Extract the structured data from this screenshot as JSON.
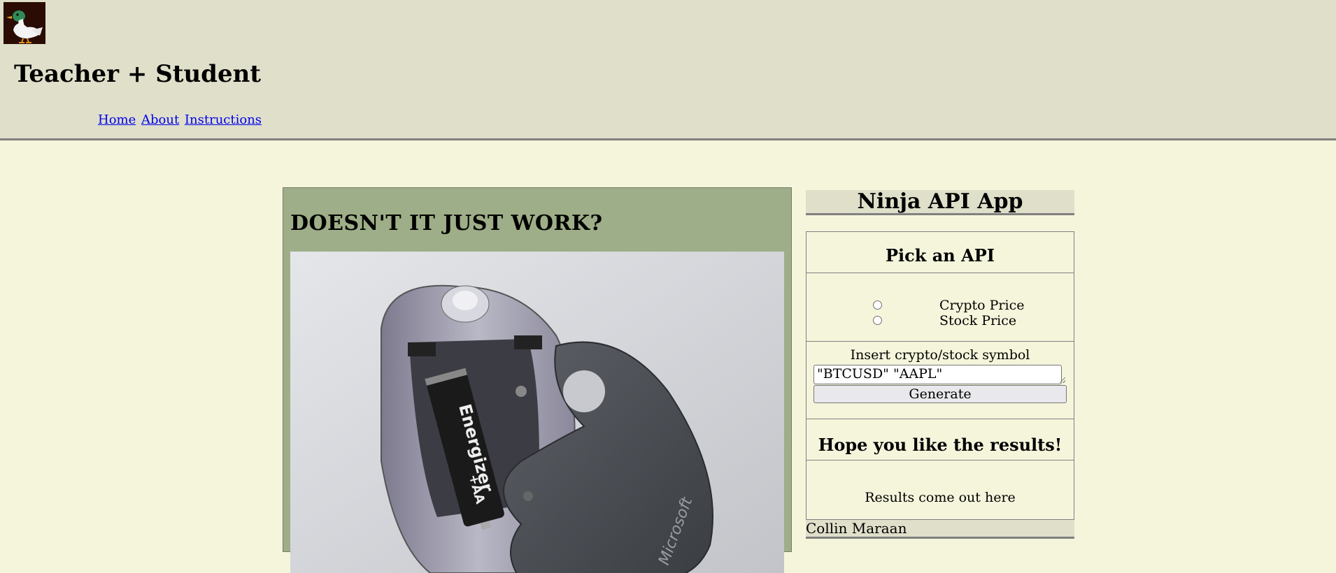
{
  "header": {
    "logo_alt": "duck logo",
    "site_title": "Teacher + Student",
    "nav": [
      "Home",
      "About",
      "Instructions"
    ]
  },
  "feature": {
    "title": "DOESN'T IT JUST WORK?",
    "image_alt": "open wireless mouse with Energizer AA battery",
    "battery_text": "Energizer",
    "battery_size": "+AA",
    "brand_text": "Microsoft"
  },
  "sidebar": {
    "app_title": "Ninja API App",
    "pick_title": "Pick an API",
    "options": [
      "Crypto Price",
      "Stock Price"
    ],
    "symbol_label": "Insert crypto/stock symbol",
    "symbol_value": "\"BTCUSD\" \"AAPL\"",
    "generate_label": "Generate",
    "results_heading": "Hope you like the results!",
    "results_text": "Results come out here"
  },
  "footer": {
    "author": "Collin Maraan"
  },
  "colors": {
    "header_bg": "#dfdfca",
    "page_bg": "#f5f5dc",
    "feature_bg": "#9eae88",
    "link": "#0000ee"
  }
}
